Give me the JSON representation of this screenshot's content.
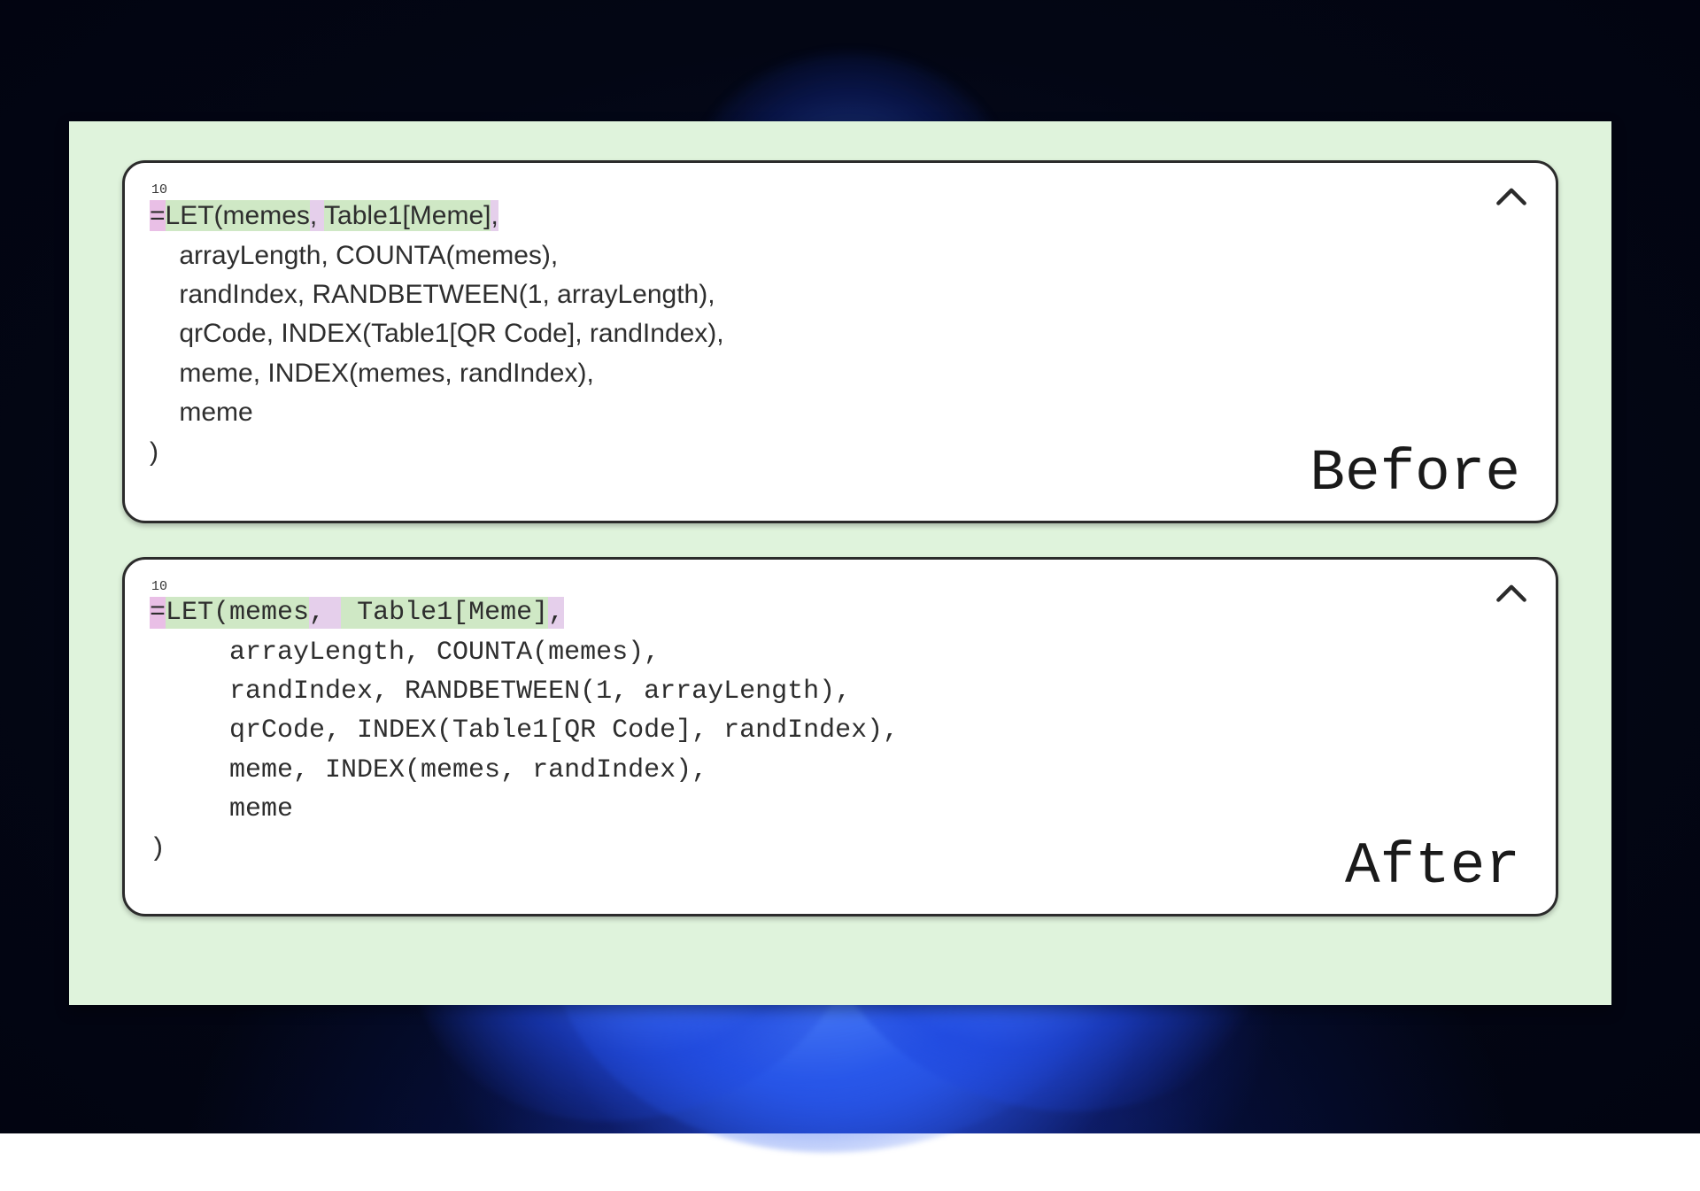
{
  "line_badge": "10",
  "labels": {
    "before": "Before",
    "after": "After"
  },
  "before": {
    "hl": {
      "eq": "=",
      "fn": "LET(",
      "arg1": "memes",
      "sep": ", ",
      "arg2": "Table1[Meme]",
      "trail": ","
    },
    "lines": [
      "    arrayLength, COUNTA(memes),",
      "    randIndex, RANDBETWEEN(1, arrayLength),",
      "    qrCode, INDEX(Table1[QR Code], randIndex),",
      "    meme, INDEX(memes, randIndex),",
      "    meme",
      ")"
    ]
  },
  "after": {
    "hl": {
      "eq": "=",
      "fn": "LET(",
      "arg1": "memes",
      "sep": ", ",
      "arg2": " Table1[Meme]",
      "trail": ","
    },
    "lines": [
      "     arrayLength, COUNTA(memes),",
      "     randIndex, RANDBETWEEN(1, arrayLength),",
      "     qrCode, INDEX(Table1[QR Code], randIndex),",
      "     meme, INDEX(memes, randIndex),",
      "     meme",
      ")"
    ]
  }
}
